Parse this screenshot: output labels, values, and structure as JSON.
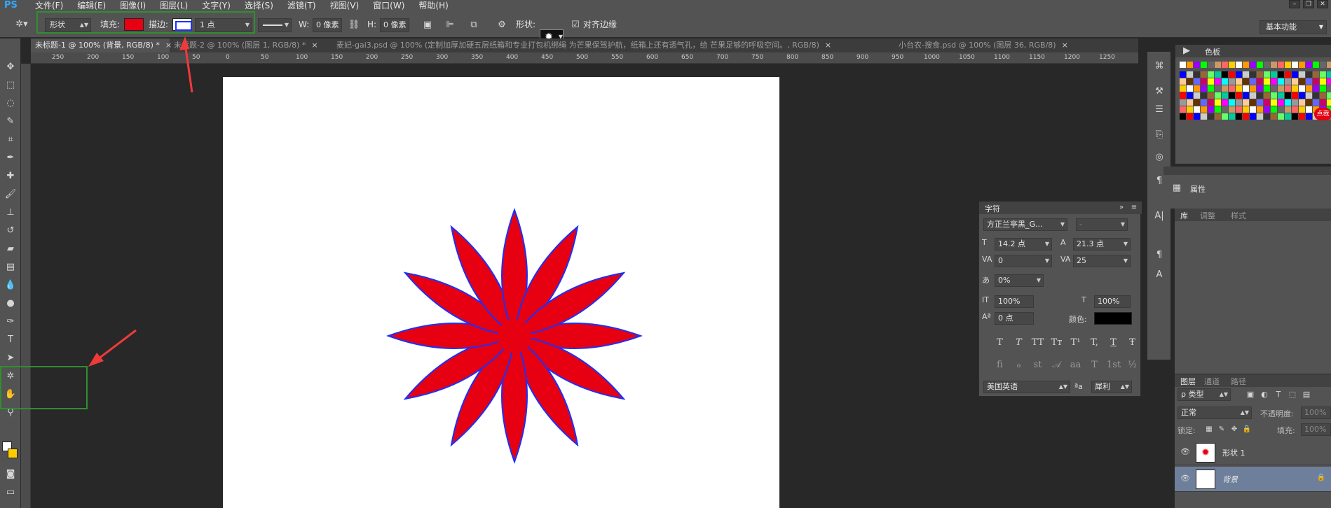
{
  "app": {
    "logo": "PS"
  },
  "menu": [
    "文件(F)",
    "编辑(E)",
    "图像(I)",
    "图层(L)",
    "文字(Y)",
    "选择(S)",
    "滤镜(T)",
    "视图(V)",
    "窗口(W)",
    "帮助(H)"
  ],
  "options": {
    "tool_mode": "形状",
    "fill_label": "填充:",
    "stroke_label": "描边:",
    "stroke_width": "1 点",
    "w_label": "W:",
    "w_value": "0 像素",
    "h_label": "H:",
    "h_value": "0 像素",
    "shape_label": "形状:",
    "align_edges": "对齐边缘",
    "workspace": "基本功能",
    "fill_color": "#e60012",
    "stroke_color": "#1a31ff"
  },
  "tabs": [
    {
      "label": "未标题-1 @ 100% (背景, RGB/8) *",
      "close": "×"
    },
    {
      "label": "未标题-2 @ 100% (图层 1, RGB/8) *",
      "close": "×"
    },
    {
      "label": "麦妃-gai3.psd @ 100% (定制加厚加硬五层纸箱和专业打包机绑绳 为芒果保驾护航，纸箱上还有透气孔，给 芒果足够的呼吸空间。, RGB/8)",
      "close": "×"
    },
    {
      "label": "小台农-搜食.psd @ 100% (图层 36, RGB/8)",
      "close": "×"
    }
  ],
  "ruler_h": [
    "250",
    "200",
    "150",
    "100",
    "50",
    "0",
    "50",
    "100",
    "150",
    "200",
    "250",
    "300",
    "350",
    "400",
    "450",
    "500",
    "550",
    "600",
    "650",
    "700",
    "750",
    "800",
    "850",
    "900",
    "950",
    "1000",
    "1050",
    "1100",
    "1150",
    "1200",
    "1250"
  ],
  "character": {
    "title": "字符",
    "font_family": "方正兰亭黑_G...",
    "font_style": "-",
    "size": "14.2 点",
    "leading": "21.3 点",
    "kerning": "0",
    "tracking": "25",
    "scale_pct": "0%",
    "vscale": "100%",
    "hscale": "100%",
    "baseline": "0 点",
    "color_label": "颜色:",
    "language": "美国英语",
    "antialias": "犀利",
    "aa_label": "ªa",
    "style_buttons": [
      "T",
      "T",
      "TT",
      "Tт",
      "T¹",
      "T,",
      "T",
      "Ŧ"
    ],
    "ot_buttons": [
      "fi",
      "ℴ",
      "st",
      "𝒜",
      "aa",
      "T",
      "1st",
      "½"
    ]
  },
  "panels": {
    "swatches": "色板",
    "properties": "属性",
    "library_tabs": [
      "库",
      "调整",
      "样式"
    ],
    "layers_tabs": [
      "图层",
      "通道",
      "路径"
    ],
    "kind": "ρ 类型",
    "blend": "正常",
    "opacity_label": "不透明度:",
    "opacity": "100%",
    "lock_label": "锁定:",
    "fill_label": "填充:",
    "fill": "100%",
    "badge": "点我加"
  },
  "layers": [
    {
      "name": "形状 1"
    },
    {
      "name": "背景"
    }
  ]
}
